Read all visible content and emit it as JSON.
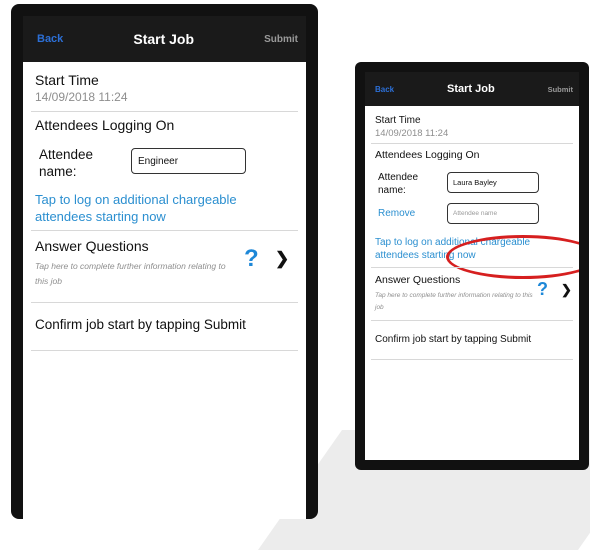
{
  "left": {
    "nav": {
      "back": "Back",
      "title": "Start Job",
      "submit": "Submit"
    },
    "start_time": {
      "label": "Start Time",
      "value": "14/09/2018 11:24"
    },
    "attendees_header": "Attendees Logging On",
    "attendee": {
      "label": "Attendee name:",
      "value": "Engineer"
    },
    "additional_link": "Tap to log on additional chargeable attendees starting now",
    "answer": {
      "title": "Answer Questions",
      "subtitle": "Tap here to complete further information relating to this job",
      "q_icon": "question-icon",
      "chevron_icon": "chevron-right-icon"
    },
    "confirm": "Confirm job start by tapping Submit"
  },
  "right": {
    "nav": {
      "back": "Back",
      "title": "Start Job",
      "submit": "Submit"
    },
    "start_time": {
      "label": "Start Time",
      "value": "14/09/2018 11:24"
    },
    "attendees_header": "Attendees Logging On",
    "attendee": {
      "label": "Attendee name:",
      "value": "Laura Bayley"
    },
    "remove": {
      "label": "Remove",
      "placeholder": "Attendee name"
    },
    "additional_link": "Tap to log on additional chargeable attendees starting now",
    "answer": {
      "title": "Answer Questions",
      "subtitle": "Tap here to complete further information relating to this job",
      "q_icon": "question-icon",
      "chevron_icon": "chevron-right-icon"
    },
    "confirm": "Confirm job start by tapping Submit"
  },
  "colors": {
    "link": "#2b8fd0",
    "nav_back": "#2c6fd6",
    "highlight_ring": "#d61f1f",
    "question": "#1e88d8"
  }
}
